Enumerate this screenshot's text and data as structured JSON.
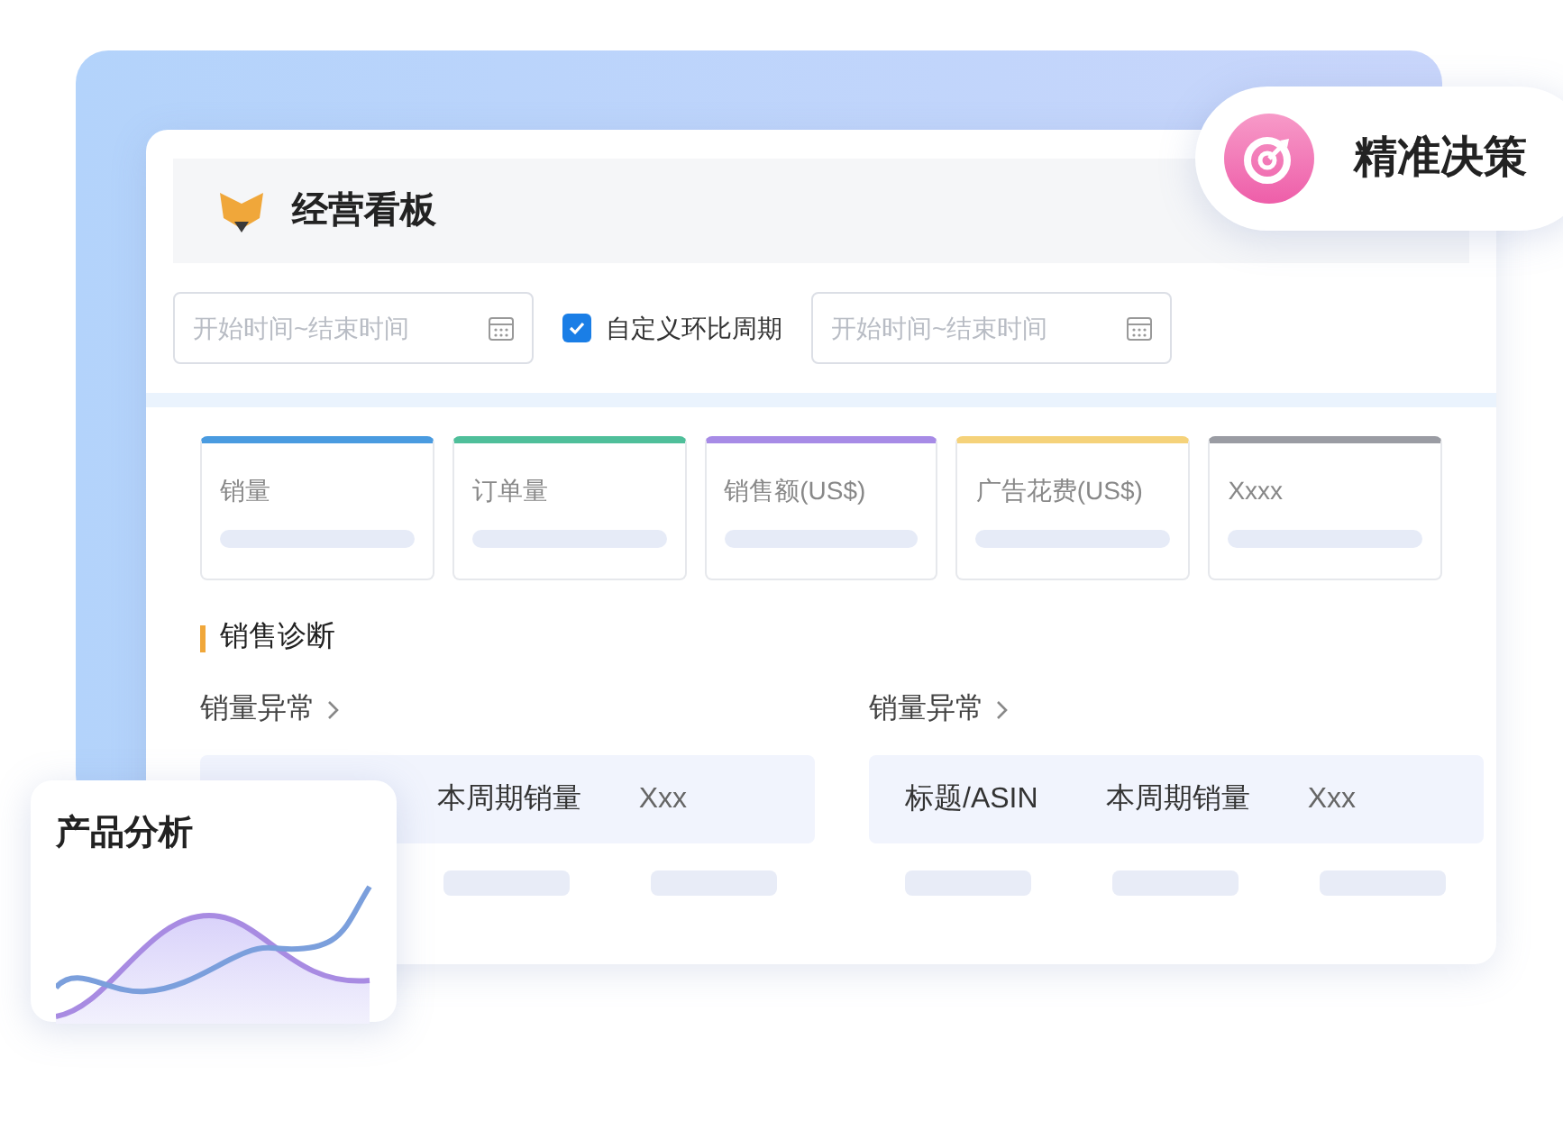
{
  "dashboard": {
    "title": "经营看板"
  },
  "filters": {
    "start_range": {
      "placeholder": "开始时间~结束时间"
    },
    "compare": {
      "label": "自定义环比周期",
      "checked": true
    },
    "compare_range": {
      "placeholder": "开始时间~结束时间"
    }
  },
  "kpis": [
    {
      "label": "销量",
      "color": "#4a9be0"
    },
    {
      "label": "订单量",
      "color": "#4fbf9a"
    },
    {
      "label": "销售额(US$)",
      "color": "#a78be6"
    },
    {
      "label": "广告花费(US$)",
      "color": "#f5d27a"
    },
    {
      "label": "Xxxx",
      "color": "#9a9ca3"
    }
  ],
  "section": {
    "title": "销售诊断"
  },
  "panels": [
    {
      "title": "销量异常",
      "columns": [
        "",
        "本周期销量",
        "Xxx"
      ]
    },
    {
      "title": "销量异常",
      "columns": [
        "标题/ASIN",
        "本周期销量",
        "Xxx"
      ]
    }
  ],
  "badge": {
    "label": "精准决策"
  },
  "product_card": {
    "title": "产品分析"
  }
}
